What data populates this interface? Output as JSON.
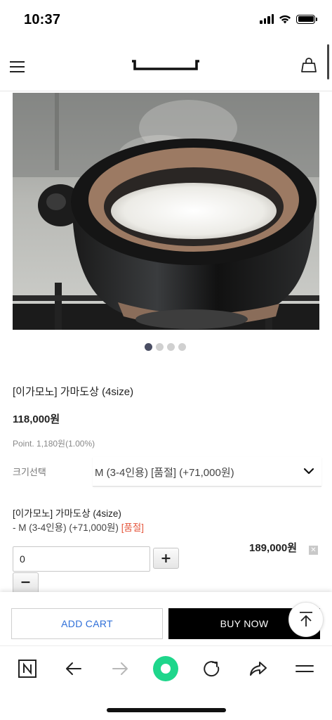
{
  "status_bar": {
    "time": "10:37"
  },
  "header": {
    "menu_icon": "hamburger-menu-icon",
    "logo_icon": "brand-logo-bracket",
    "cart_icon": "shopping-bag-icon"
  },
  "gallery": {
    "image_subject": "clay pot of steaming rice on stove",
    "pages": 4,
    "current_page": 1
  },
  "product": {
    "name": "[이가모노] 가마도상 (4size)",
    "price": "118,000원",
    "point": "Point. 1,180원(1.00%)"
  },
  "option": {
    "label": "크기선택",
    "selected": "M (3-4인용) [품절] (+71,000원)"
  },
  "selection": {
    "name": "[이가모노] 가마도상 (4size)",
    "detail": "- M (3-4인용) (+71,000원)",
    "status": "[품절]",
    "quantity": "0",
    "plus_label": "+",
    "minus_label": "−",
    "price": "189,000원",
    "delete_label": "✕"
  },
  "actions": {
    "add_cart": "ADD CART",
    "buy_now": "BUY NOW"
  },
  "browser_toolbar": {
    "items": [
      "naver-icon",
      "back-icon",
      "forward-icon",
      "green-dot-icon",
      "refresh-icon",
      "share-icon",
      "menu-icon"
    ]
  },
  "colors": {
    "accent_blue": "#2f6fd8",
    "soldout_red": "#e5573d",
    "browser_green": "#1ed68b"
  }
}
